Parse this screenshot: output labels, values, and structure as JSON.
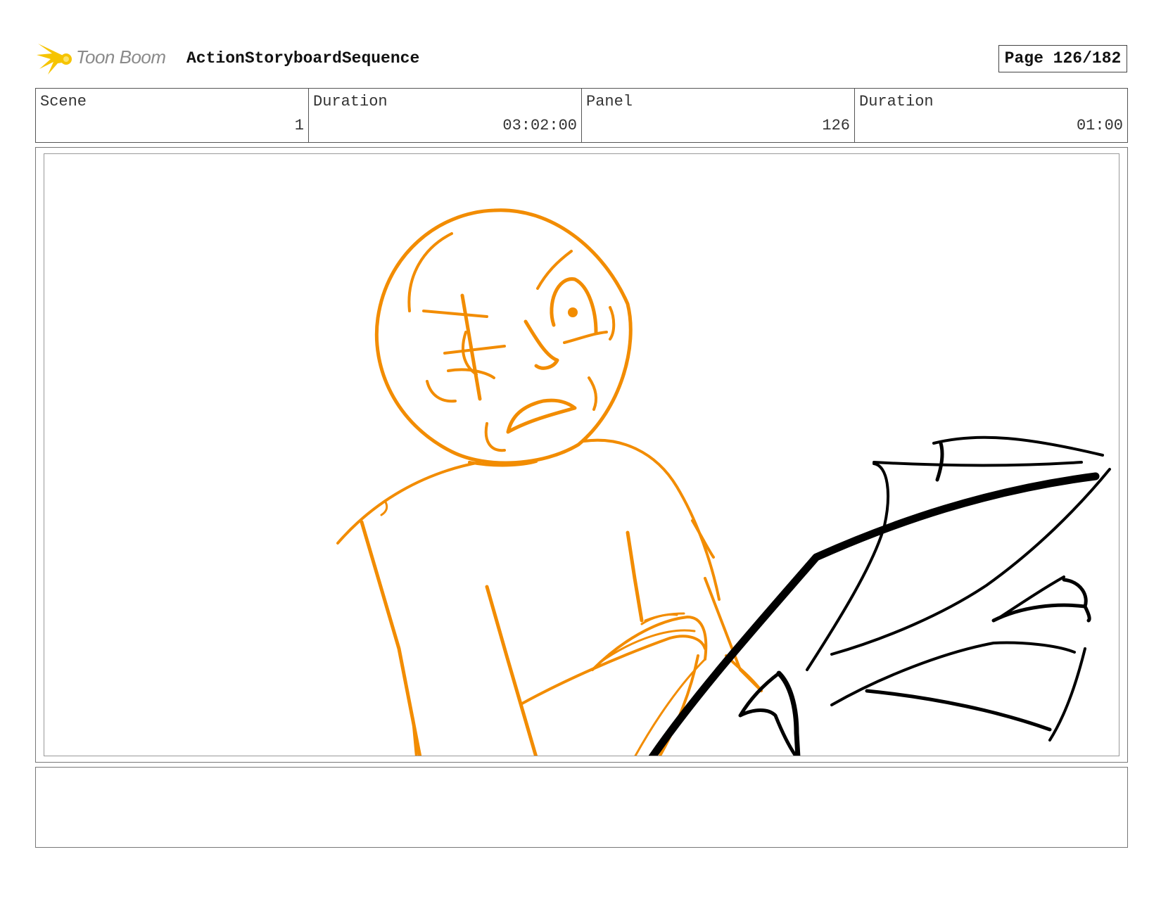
{
  "header": {
    "logo_text": "Toon Boom",
    "title": "ActionStoryboardSequence",
    "page_label": "Page 126/182"
  },
  "info": {
    "scene_label": "Scene",
    "scene_value": "1",
    "scene_duration_label": "Duration",
    "scene_duration_value": "03:02:00",
    "panel_label": "Panel",
    "panel_value": "126",
    "panel_duration_label": "Duration",
    "panel_duration_value": "01:00"
  },
  "notes": {
    "text": ""
  },
  "colors": {
    "sketch_orange": "#f28c00",
    "sketch_black": "#000000",
    "logo_yellow": "#f6c400"
  }
}
